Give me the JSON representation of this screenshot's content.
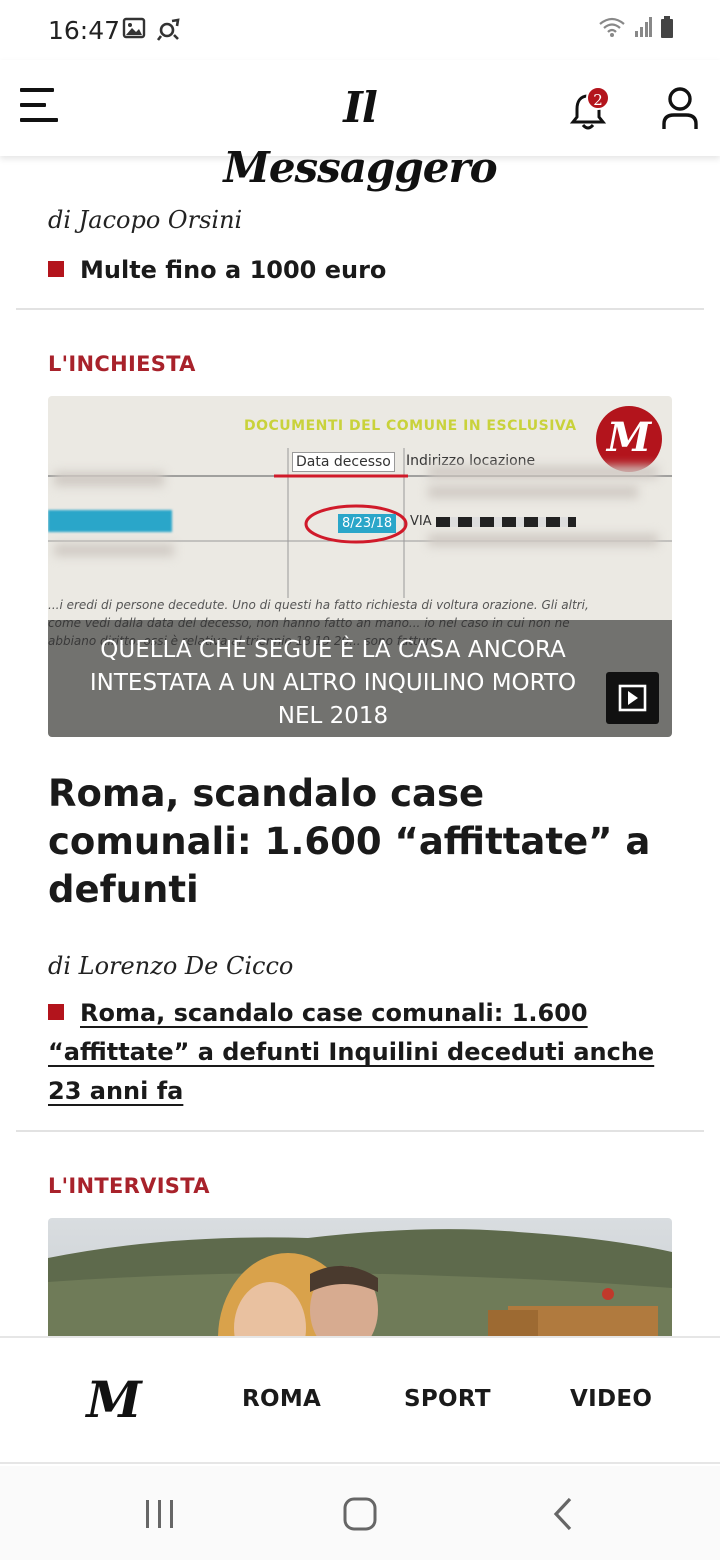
{
  "status_bar": {
    "time": "16:47",
    "left_icons": [
      "image-icon",
      "notification-app-icon"
    ],
    "right_icons": [
      "wifi-icon",
      "signal-icon",
      "battery-icon"
    ]
  },
  "header": {
    "brand": "Il Messaggero",
    "notifications_count": "2",
    "accent_color": "#b3141c"
  },
  "top_article": {
    "byline": "di Jacopo Orsini",
    "related_link": "Multe fino a 1000 euro"
  },
  "article_1": {
    "kicker": "L'INCHIESTA",
    "image": {
      "doc_header": "DOCUMENTI DEL COMUNE IN ESCLUSIVA",
      "logo_letter": "M",
      "col_label_1": "Data decesso",
      "col_label_2": "Indirizzo locazione",
      "date_value": "8/23/18",
      "via_value": "VIA",
      "paragraph": "...i eredi di persone decedute. Uno di questi ha fatto richiesta di voltura orazione. Gli altri, come vedi dalla data del decesso, non hanno fatto an mano... io nel caso in cui non ne abbiano diritto. ossi è relativa al triennio 18 19 20... sono fatture",
      "caption": "QUELLA CHE SEGUE È LA CASA ANCORA INTESTATA A UN ALTRO INQUILINO MORTO NEL 2018"
    },
    "headline": "Roma, scandalo case comunali: 1.600 “affittate” a defunti",
    "byline": "di Lorenzo De Cicco",
    "related_link": "Roma, scandalo case comunali: 1.600 “affittate” a defunti Inquilini deceduti anche 23 anni fa"
  },
  "article_2": {
    "kicker": "L'INTERVISTA"
  },
  "bottom_nav": {
    "logo": "M",
    "items": [
      "ROMA",
      "SPORT",
      "VIDEO"
    ]
  },
  "system_nav": [
    "recent-apps-icon",
    "home-icon",
    "back-icon"
  ]
}
